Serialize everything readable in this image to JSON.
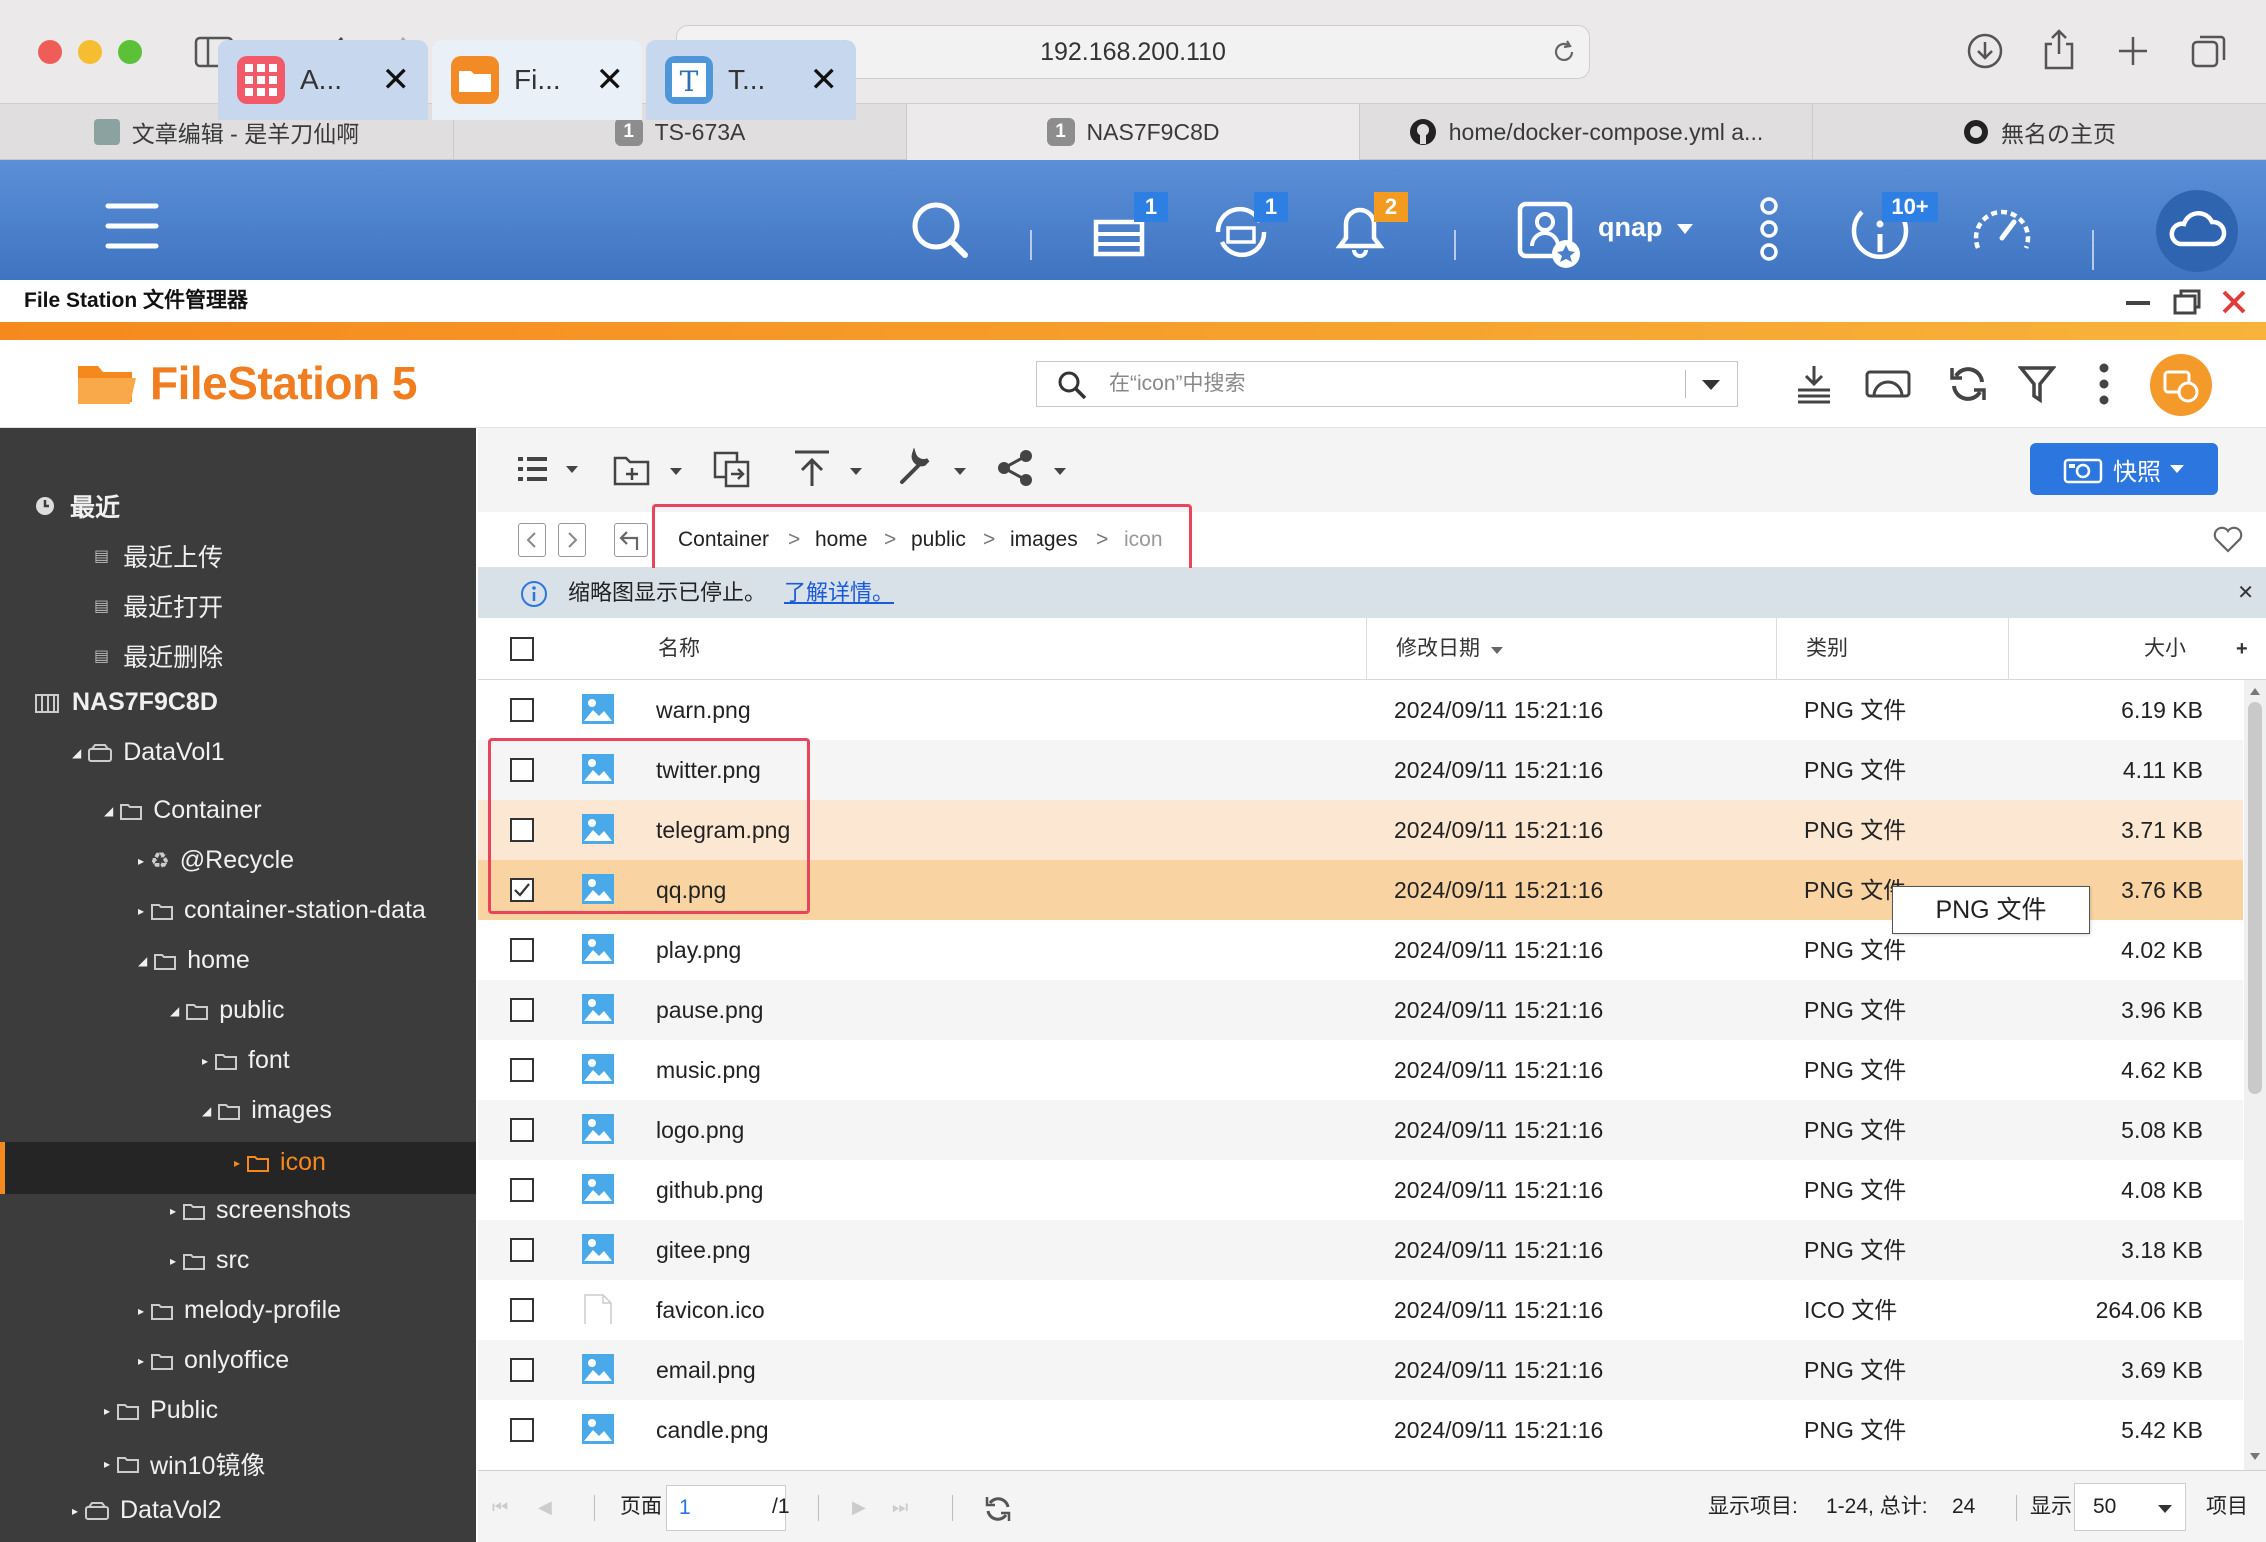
{
  "browser": {
    "url": "192.168.200.110",
    "tabs": [
      {
        "label": "文章编辑 - 是羊刀仙啊"
      },
      {
        "label": "TS-673A",
        "num": "1"
      },
      {
        "label": "NAS7F9C8D",
        "num": "1"
      },
      {
        "label": "home/docker-compose.yml a..."
      },
      {
        "label": "無名の主页"
      }
    ]
  },
  "taskbar": {
    "apps": [
      {
        "label": "A..."
      },
      {
        "label": "Fi..."
      },
      {
        "label": "T..."
      }
    ],
    "badges": {
      "tasks": "1",
      "sync": "1",
      "notify": "2",
      "info": "10+"
    },
    "user": "qnap"
  },
  "window": {
    "title": "File Station 文件管理器"
  },
  "app": {
    "brand": "FileStation 5",
    "search_placeholder": "在“icon”中搜索",
    "snapshot_label": "快照"
  },
  "sidebar": {
    "recent": "最近",
    "recent_upload": "最近上传",
    "recent_open": "最近打开",
    "recent_delete": "最近删除",
    "nas": "NAS7F9C8D",
    "vol1": "DataVol1",
    "container": "Container",
    "recycle": "@Recycle",
    "csd": "container-station-data",
    "home": "home",
    "public": "public",
    "font": "font",
    "images": "images",
    "icon": "icon",
    "screenshots": "screenshots",
    "src": "src",
    "melody": "melody-profile",
    "onlyoffice": "onlyoffice",
    "Public": "Public",
    "win10": "win10镜像",
    "vol2": "DataVol2"
  },
  "breadcrumb": [
    "Container",
    "home",
    "public",
    "images",
    "icon"
  ],
  "info": {
    "text": "缩略图显示已停止。",
    "link": "了解详情。"
  },
  "columns": {
    "name": "名称",
    "date": "修改日期",
    "type": "类别",
    "size": "大小"
  },
  "files": [
    {
      "name": "warn.png",
      "date": "2024/09/11 15:21:16",
      "type": "PNG 文件",
      "size": "6.19 KB",
      "icon": "image-icon",
      "checked": false
    },
    {
      "name": "twitter.png",
      "date": "2024/09/11 15:21:16",
      "type": "PNG 文件",
      "size": "4.11 KB",
      "icon": "image-icon",
      "checked": false
    },
    {
      "name": "telegram.png",
      "date": "2024/09/11 15:21:16",
      "type": "PNG 文件",
      "size": "3.71 KB",
      "icon": "image-icon",
      "checked": false
    },
    {
      "name": "qq.png",
      "date": "2024/09/11 15:21:16",
      "type": "PNG 文件",
      "size": "3.76 KB",
      "icon": "image-icon",
      "checked": true
    },
    {
      "name": "play.png",
      "date": "2024/09/11 15:21:16",
      "type": "PNG 文件",
      "size": "4.02 KB",
      "icon": "image-icon",
      "checked": false
    },
    {
      "name": "pause.png",
      "date": "2024/09/11 15:21:16",
      "type": "PNG 文件",
      "size": "3.96 KB",
      "icon": "image-icon",
      "checked": false
    },
    {
      "name": "music.png",
      "date": "2024/09/11 15:21:16",
      "type": "PNG 文件",
      "size": "4.62 KB",
      "icon": "image-icon",
      "checked": false
    },
    {
      "name": "logo.png",
      "date": "2024/09/11 15:21:16",
      "type": "PNG 文件",
      "size": "5.08 KB",
      "icon": "image-icon",
      "checked": false
    },
    {
      "name": "github.png",
      "date": "2024/09/11 15:21:16",
      "type": "PNG 文件",
      "size": "4.08 KB",
      "icon": "image-icon",
      "checked": false
    },
    {
      "name": "gitee.png",
      "date": "2024/09/11 15:21:16",
      "type": "PNG 文件",
      "size": "3.18 KB",
      "icon": "image-icon",
      "checked": false
    },
    {
      "name": "favicon.ico",
      "date": "2024/09/11 15:21:16",
      "type": "ICO 文件",
      "size": "264.06 KB",
      "icon": "file-icon",
      "checked": false
    },
    {
      "name": "email.png",
      "date": "2024/09/11 15:21:16",
      "type": "PNG 文件",
      "size": "3.69 KB",
      "icon": "image-icon",
      "checked": false
    },
    {
      "name": "candle.png",
      "date": "2024/09/11 15:21:16",
      "type": "PNG 文件",
      "size": "5.42 KB",
      "icon": "image-icon",
      "checked": false
    }
  ],
  "tooltip": "PNG 文件",
  "footer": {
    "page_label": "页面",
    "page_value": "1",
    "page_total": "/1",
    "display_items_label": "显示项目:",
    "display_items_value": "1-24, 总计:",
    "total": "24",
    "show_label": "显示",
    "per_page": "50",
    "items_label": "项目"
  },
  "colors": {
    "accent": "#f5891d",
    "selected_row": "#f9d4a2",
    "hover_row": "#fce8d2",
    "link": "#1a5bd8",
    "snapshot": "#2c76e0"
  }
}
